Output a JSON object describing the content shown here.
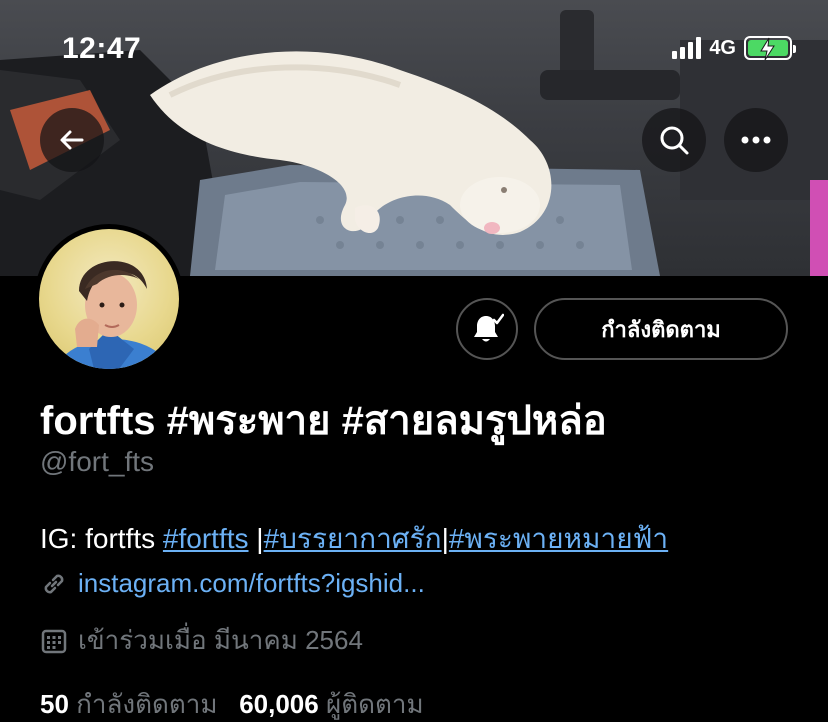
{
  "status_bar": {
    "time": "12:47",
    "network": "4G",
    "icons": [
      "signal-icon",
      "battery-charging-icon"
    ]
  },
  "header": {
    "icons": [
      "back-arrow-icon",
      "search-icon",
      "more-icon"
    ]
  },
  "profile": {
    "display_name": "fortfts #พระพาย #สายลมรูปหล่อ",
    "handle": "@fort_fts",
    "follow_button_label": "กำลังติดตาม",
    "notification_icon": "bell-check-icon",
    "bio": {
      "prefix": "IG: fortfts ",
      "hashtags": [
        "#fortfts",
        "#บรรยากาศรัก",
        "#พระพายหมายฟ้า"
      ],
      "separator": "|"
    },
    "website": "instagram.com/fortfts?igshid...",
    "joined": "เข้าร่วมเมื่อ มีนาคม 2564",
    "following_count": "50",
    "following_label": "กำลังติดตาม",
    "followers_count": "60,006",
    "followers_label": "ผู้ติดตาม"
  },
  "colors": {
    "background": "#000000",
    "link": "#6cb1f5",
    "secondary_text": "#71767b",
    "battery": "#4cd964"
  }
}
